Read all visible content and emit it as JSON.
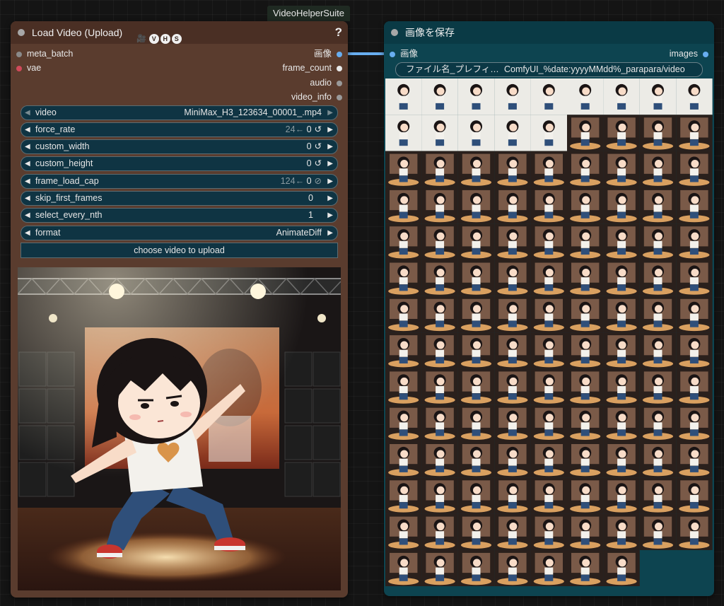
{
  "group": {
    "label": "VideoHelperSuite"
  },
  "load_node": {
    "title": "Load Video (Upload)",
    "title_emoji": "🎥",
    "badges": [
      "V",
      "H",
      "S"
    ],
    "help": "?",
    "inputs": [
      {
        "label": "meta_batch",
        "color": "gray"
      },
      {
        "label": "vae",
        "color": "pink"
      }
    ],
    "outputs": [
      {
        "label": "画像",
        "color": "blue"
      },
      {
        "label": "frame_count",
        "color": "white"
      },
      {
        "label": "audio",
        "color": "dim"
      },
      {
        "label": "video_info",
        "color": "dim"
      }
    ],
    "widgets": [
      {
        "label": "video",
        "value": "MiniMax_H3_123634_00001_.mp4",
        "type": "combo",
        "disabled": true
      },
      {
        "label": "force_rate",
        "value": "0",
        "extra": "24←",
        "icon": "↺",
        "type": "number"
      },
      {
        "label": "custom_width",
        "value": "0",
        "icon": "↺",
        "type": "number"
      },
      {
        "label": "custom_height",
        "value": "0",
        "icon": "↺",
        "type": "number"
      },
      {
        "label": "frame_load_cap",
        "value": "0",
        "extra": "124←",
        "icon": "⊘",
        "type": "number"
      },
      {
        "label": "skip_first_frames",
        "value": "0",
        "type": "number"
      },
      {
        "label": "select_every_nth",
        "value": "1",
        "type": "number"
      },
      {
        "label": "format",
        "value": "AnimateDiff",
        "type": "combo"
      }
    ],
    "upload_label": "choose video to upload"
  },
  "save_node": {
    "title": "画像を保存",
    "input": {
      "label": "画像",
      "color": "blue"
    },
    "output": {
      "label": "images",
      "color": "blue"
    },
    "filename_widget": {
      "label": "ファイル名_プレフィ…",
      "value": "ComfyUI_%date:yyyyMMdd%_parapara/video"
    },
    "frame_count": 124,
    "grid_columns": 9,
    "grid_rows": 14
  },
  "colors": {
    "link": "#68aef0",
    "load_bg": "#5a3c2e",
    "save_bg": "#0d4450"
  }
}
